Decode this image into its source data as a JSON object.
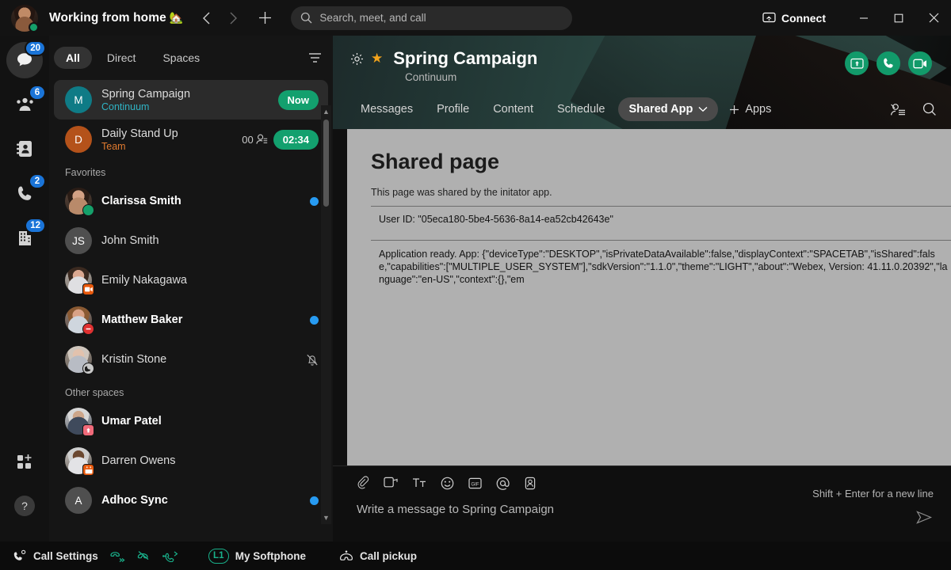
{
  "titlebar": {
    "status_text": "Working from home",
    "status_emoji": "🏡",
    "back_icon": "chevron-left-icon",
    "forward_icon": "chevron-right-icon",
    "new_icon": "plus-icon",
    "search_placeholder": "Search, meet, and call",
    "connect_label": "Connect",
    "minimize_label": "—",
    "maximize_label": "▢",
    "close_label": "✕"
  },
  "rail": {
    "items": [
      {
        "name": "messaging",
        "icon": "chat-bubble-icon",
        "badge": "20",
        "active": true
      },
      {
        "name": "teams",
        "icon": "teams-icon",
        "badge": "6",
        "active": false
      },
      {
        "name": "contacts",
        "icon": "contact-card-icon",
        "badge": "",
        "active": false
      },
      {
        "name": "calling",
        "icon": "phone-icon",
        "badge": "2",
        "active": false
      },
      {
        "name": "workspaces",
        "icon": "building-icon",
        "badge": "12",
        "active": false
      }
    ],
    "apps_icon": "apps-grid-plus-icon",
    "help_label": "?"
  },
  "list": {
    "filters": [
      {
        "label": "All",
        "active": true
      },
      {
        "label": "Direct",
        "active": false
      },
      {
        "label": "Spaces",
        "active": false
      }
    ],
    "filter_icon": "filter-lines-icon",
    "top_items": [
      {
        "title": "Spring Campaign",
        "subtitle": "Continuum",
        "subtitle_color": "teal",
        "avatar_initial": "M",
        "avatar_style": "teal",
        "pill": "Now",
        "selected": true,
        "bold": false,
        "unread": false,
        "badge": "",
        "count": ""
      },
      {
        "title": "Daily Stand Up",
        "subtitle": "Team",
        "subtitle_color": "orange",
        "avatar_initial": "D",
        "avatar_style": "orange",
        "pill": "02:34",
        "selected": false,
        "bold": false,
        "unread": false,
        "badge": "",
        "count": "00"
      }
    ],
    "favorites_label": "Favorites",
    "favorites": [
      {
        "title": "Clarissa Smith",
        "avatar_initial": "",
        "avatar_style": "photo-a",
        "badge": "green",
        "bold": true,
        "unread": true,
        "muted": false
      },
      {
        "title": "John Smith",
        "avatar_initial": "JS",
        "avatar_style": "grey",
        "badge": "",
        "bold": false,
        "unread": false,
        "muted": false
      },
      {
        "title": "Emily Nakagawa",
        "avatar_initial": "",
        "avatar_style": "photo-b",
        "badge": "video",
        "bold": false,
        "unread": false,
        "muted": false
      },
      {
        "title": "Matthew Baker",
        "avatar_initial": "",
        "avatar_style": "photo-c",
        "badge": "dnd",
        "bold": true,
        "unread": true,
        "muted": false
      },
      {
        "title": "Kristin Stone",
        "avatar_initial": "",
        "avatar_style": "photo-d",
        "badge": "moon",
        "bold": false,
        "unread": false,
        "muted": true
      }
    ],
    "other_label": "Other spaces",
    "other_spaces": [
      {
        "title": "Umar Patel",
        "avatar_initial": "",
        "avatar_style": "photo-e",
        "badge": "present",
        "bold": true,
        "unread": false,
        "muted": false
      },
      {
        "title": "Darren Owens",
        "avatar_initial": "",
        "avatar_style": "photo-f",
        "badge": "cal",
        "bold": false,
        "unread": false,
        "muted": false
      },
      {
        "title": "Adhoc Sync",
        "avatar_initial": "A",
        "avatar_style": "grey",
        "badge": "",
        "bold": true,
        "unread": true,
        "muted": false
      }
    ]
  },
  "space": {
    "settings_icon": "gear-icon",
    "favorite_icon": "star-icon",
    "title": "Spring Campaign",
    "subtitle": "Continuum",
    "actions": [
      {
        "name": "share-screen",
        "icon": "screen-share-icon"
      },
      {
        "name": "audio-call",
        "icon": "phone-icon"
      },
      {
        "name": "video-call",
        "icon": "video-camera-icon"
      }
    ],
    "tabs": [
      {
        "label": "Messages",
        "active": false,
        "chevron": false
      },
      {
        "label": "Profile",
        "active": false,
        "chevron": false
      },
      {
        "label": "Content",
        "active": false,
        "chevron": false
      },
      {
        "label": "Schedule",
        "active": false,
        "chevron": false
      },
      {
        "label": "Shared App",
        "active": true,
        "chevron": true
      }
    ],
    "add_apps_label": "Apps",
    "add_apps_icon": "plus-icon",
    "people_icon": "people-list-icon",
    "search_icon": "search-icon",
    "accent_green": "#129a6a",
    "accent_star": "#f2a31b"
  },
  "shared_page": {
    "heading": "Shared page",
    "description": "This page was shared by the initator app.",
    "user_id_row": "User ID: \"05eca180-5be4-5636-8a14-ea52cb42643e\"",
    "app_ready_row": "Application ready. App: {\"deviceType\":\"DESKTOP\",\"isPrivateDataAvailable\":false,\"displayContext\":\"SPACETAB\",\"isShared\":false,\"capabilities\":[\"MULTIPLE_USER_SYSTEM\"],\"sdkVersion\":\"1.1.0\",\"theme\":\"LIGHT\",\"about\":\"Webex, Version: 41.11.0.20392\",\"language\":\"en-US\",\"context\":{},\"em"
  },
  "composer": {
    "icons": [
      {
        "name": "attachment-icon"
      },
      {
        "name": "screen-share-icon"
      },
      {
        "name": "text-format-icon"
      },
      {
        "name": "emoji-icon"
      },
      {
        "name": "gif-icon"
      },
      {
        "name": "mention-icon"
      },
      {
        "name": "sticker-person-icon"
      }
    ],
    "placeholder": "Write a message to Spring Campaign",
    "hint": "Shift + Enter for a new line",
    "send_icon": "send-arrow-icon"
  },
  "statusbar": {
    "call_settings_label": "Call Settings",
    "call_settings_icon": "phone-settings-icon",
    "telephony_icons": [
      {
        "name": "call-forward-icon"
      },
      {
        "name": "do-not-disturb-call-icon"
      },
      {
        "name": "call-transfer-icon"
      }
    ],
    "line_label": "L1",
    "softphone_label": "My Softphone",
    "call_pickup_label": "Call pickup",
    "call_pickup_icon": "call-pickup-icon",
    "accent_teal": "#19b08a"
  }
}
